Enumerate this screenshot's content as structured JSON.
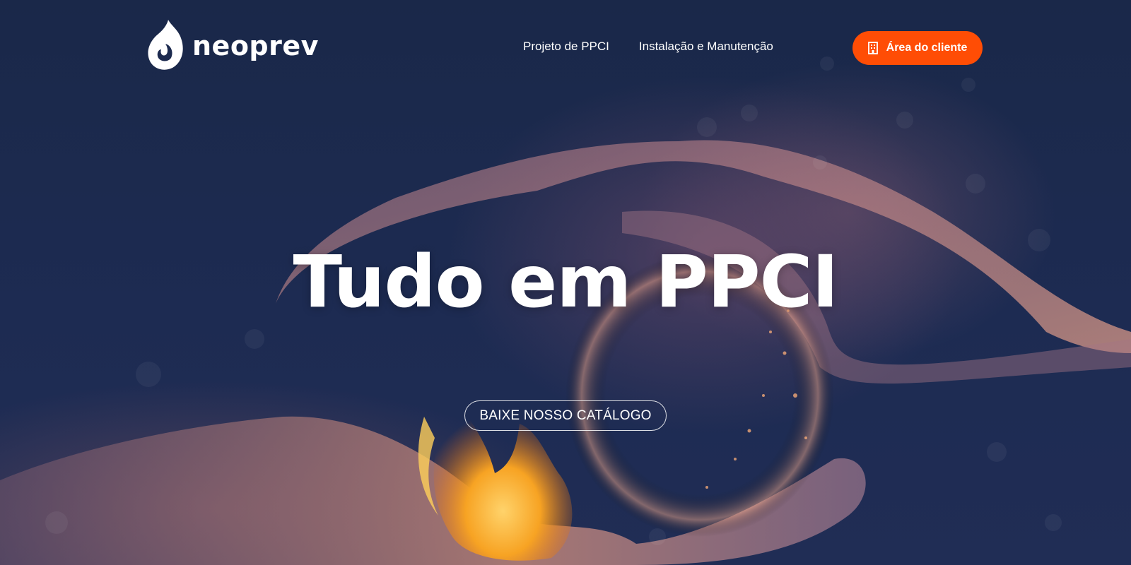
{
  "brand": {
    "name": "neoprev",
    "logo_icon": "flame-drop-icon"
  },
  "nav": {
    "items": [
      {
        "label": "Projeto de PPCI"
      },
      {
        "label": "Instalação e Manutenção"
      }
    ]
  },
  "cta": {
    "label": "Área do cliente",
    "icon": "building-icon",
    "color": "#ff4d05"
  },
  "hero": {
    "title": "Tudo em PPCI",
    "button_label": "BAIXE NOSSO CATÁLOGO"
  },
  "colors": {
    "background": "#1c2a4f",
    "accent": "#ff4d05",
    "flame": "#f5a623"
  }
}
